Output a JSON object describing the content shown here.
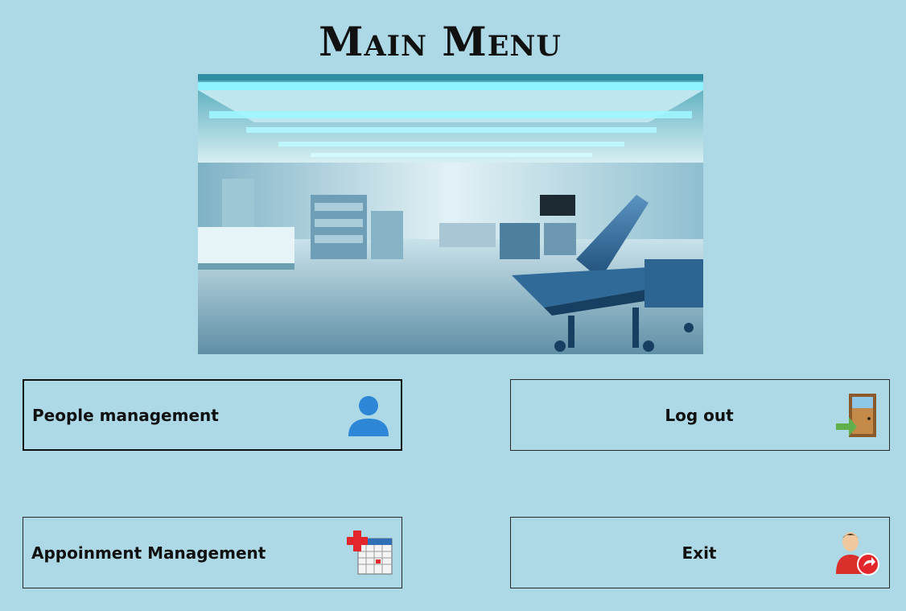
{
  "window": {
    "title": "Main Menu"
  },
  "hero": {
    "image": "hospital-room-image"
  },
  "buttons": {
    "people": {
      "label": "People management",
      "icon": "person-icon"
    },
    "logout": {
      "label": "Log out",
      "icon": "door-exit-icon"
    },
    "appointment": {
      "label": "Appoinment Management",
      "icon": "medical-calendar-icon"
    },
    "exit": {
      "label": "Exit",
      "icon": "user-exit-icon"
    }
  },
  "colors": {
    "background": "#add8e6",
    "person_icon": "#2d87d6",
    "cross": "#e2262b"
  }
}
